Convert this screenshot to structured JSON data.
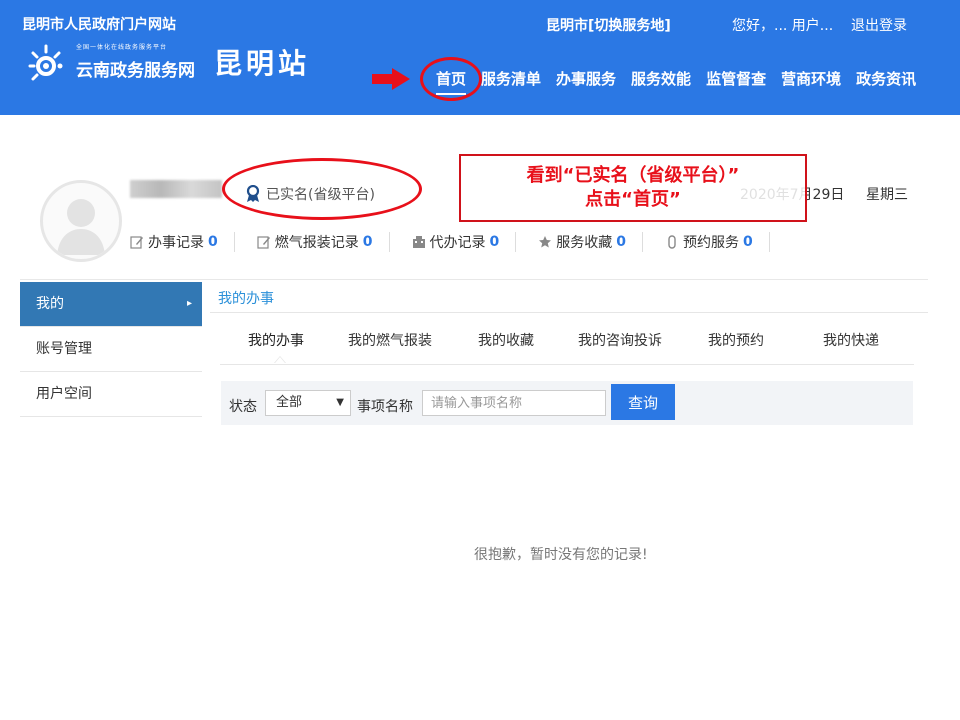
{
  "header": {
    "portal_link": "昆明市人民政府门户网站",
    "logo": {
      "slogan": "全国一体化在线政务服务平台",
      "name": "云南政务服务网",
      "station": "昆明站"
    },
    "city_switch": "昆明市[切换服务地]",
    "user_greeting": "您好，... 用户...",
    "logout": "退出登录",
    "nav": [
      {
        "label": "首页",
        "active": true
      },
      {
        "label": "服务清单"
      },
      {
        "label": "办事服务"
      },
      {
        "label": "服务效能"
      },
      {
        "label": "监管督查"
      },
      {
        "label": "营商环境"
      },
      {
        "label": "政务资讯"
      }
    ]
  },
  "annotation": {
    "line1": "看到“已实名（省级平台）”",
    "line2": "点击“首页”",
    "color": "#e8101a"
  },
  "profile": {
    "verified_label": "已实名(省级平台)",
    "date": "2020年7月29日",
    "weekday": "星期三",
    "stats": [
      {
        "label": "办事记录",
        "count": "0",
        "icon": "edit-icon"
      },
      {
        "label": "燃气报装记录",
        "count": "0",
        "icon": "edit-icon"
      },
      {
        "label": "代办记录",
        "count": "0",
        "icon": "building-icon"
      },
      {
        "label": "服务收藏",
        "count": "0",
        "icon": "star-icon"
      },
      {
        "label": "预约服务",
        "count": "0",
        "icon": "clip-icon"
      }
    ]
  },
  "sidebar": {
    "items": [
      {
        "label": "我的",
        "active": true
      },
      {
        "label": "账号管理"
      },
      {
        "label": "用户空间"
      }
    ]
  },
  "main": {
    "section_title": "我的办事",
    "tabs": [
      {
        "label": "我的办事",
        "active": true
      },
      {
        "label": "我的燃气报装"
      },
      {
        "label": "我的收藏"
      },
      {
        "label": "我的咨询投诉"
      },
      {
        "label": "我的预约"
      },
      {
        "label": "我的快递"
      }
    ],
    "filter": {
      "status_label": "状态",
      "status_value": "全部",
      "name_label": "事项名称",
      "name_placeholder": "请输入事项名称",
      "query_button": "查询"
    },
    "empty_message": "很抱歉，暂时没有您的记录!"
  },
  "colors": {
    "header_bg": "#2b78e4",
    "accent": "#2b78e4",
    "sidebar_active": "#3278b4",
    "annotation_red": "#e8101a"
  }
}
